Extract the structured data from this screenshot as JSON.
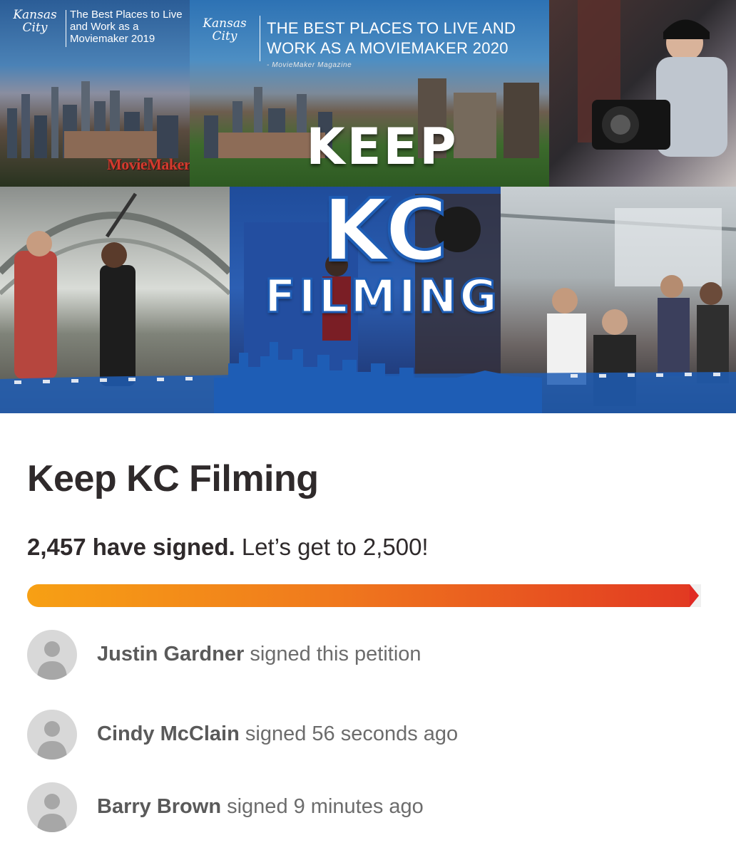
{
  "hero": {
    "logo_line1": "Kansas",
    "logo_line2": "City",
    "badge_2019": "The Best Places to Live and Work as a Moviemaker 2019",
    "badge_2020_line1": "THE BEST PLACES TO LIVE AND",
    "badge_2020_line2": "WORK AS A MOVIEMAKER 2020",
    "magazine_credit": "- MovieMaker Magazine",
    "moviemaker_logo": "MovieMaker",
    "headline_keep": "KEEP",
    "headline_kc": "KC",
    "headline_filming": "FILMING"
  },
  "petition": {
    "title": "Keep KC Filming",
    "signed_count": "2,457 have signed.",
    "goal_text": "Let’s get to 2,500!",
    "signed_number": 2457,
    "goal_number": 2500,
    "progress_fraction": 0.983
  },
  "signers": [
    {
      "name": "Justin Gardner",
      "action": "signed this petition"
    },
    {
      "name": "Cindy McClain",
      "action": "signed 56 seconds ago"
    },
    {
      "name": "Barry Brown",
      "action": "signed 9 minutes ago"
    }
  ],
  "colors": {
    "progress_start": "#f7a014",
    "progress_end": "#e23a22",
    "brand_blue": "#1e5db5",
    "text_dark": "#2f2a2b",
    "text_muted": "#6c6c6c"
  },
  "icons": {
    "avatar": "default-avatar-icon"
  }
}
